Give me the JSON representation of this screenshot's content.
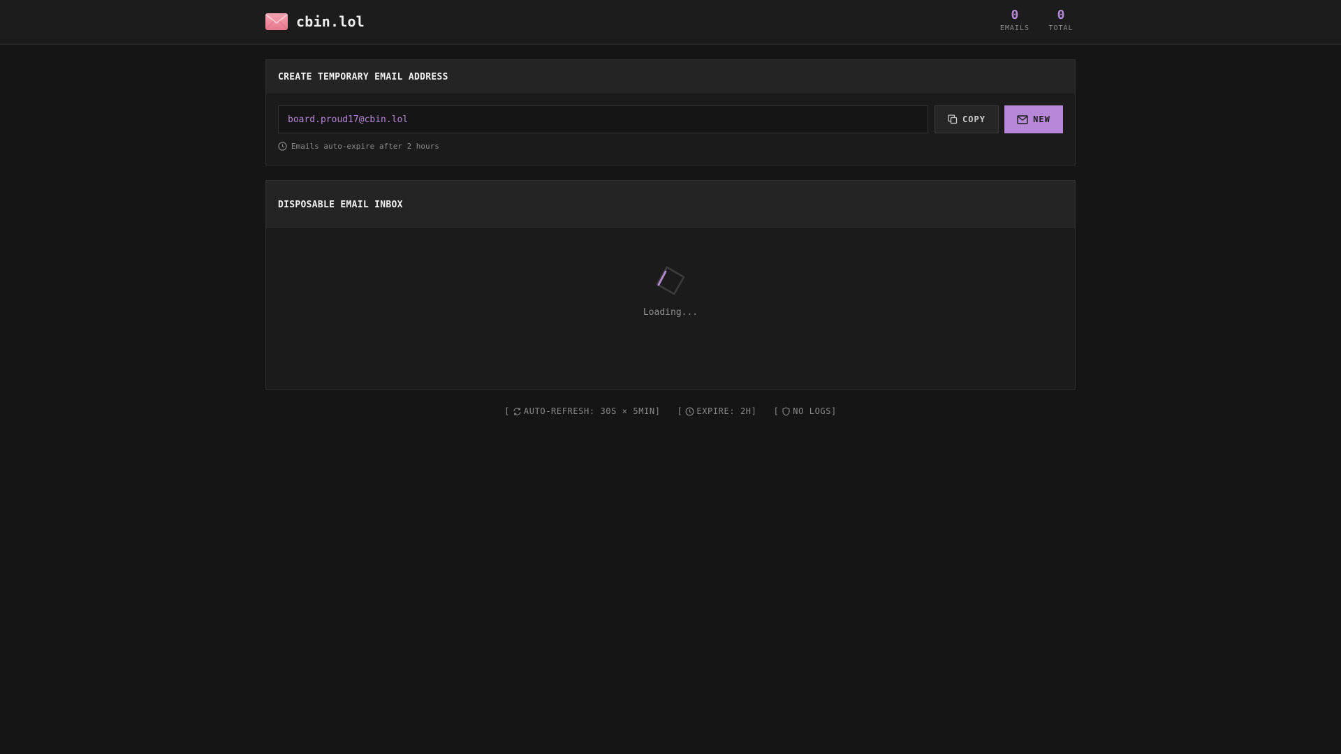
{
  "header": {
    "brand": "cbin.lol",
    "logo_icon": "envelope-icon",
    "stats": [
      {
        "value": "0",
        "label": "EMAILS"
      },
      {
        "value": "0",
        "label": "TOTAL"
      }
    ]
  },
  "create": {
    "title": "CREATE TEMPORARY EMAIL ADDRESS",
    "email": "board.proud17@cbin.lol",
    "copy_label": "COPY",
    "new_label": "NEW",
    "note": "Emails auto-expire after 2 hours"
  },
  "inbox": {
    "title": "DISPOSABLE EMAIL INBOX",
    "loading": "Loading..."
  },
  "footer": {
    "auto_refresh": "AUTO-REFRESH: 30S × 5MIN]",
    "expire": "EXPIRE: 2H]",
    "no_logs": "NO LOGS]",
    "bracket": "["
  },
  "colors": {
    "accent": "#b888d8",
    "background": "#151515",
    "card": "#1b1b1b",
    "card_header": "#242424"
  }
}
